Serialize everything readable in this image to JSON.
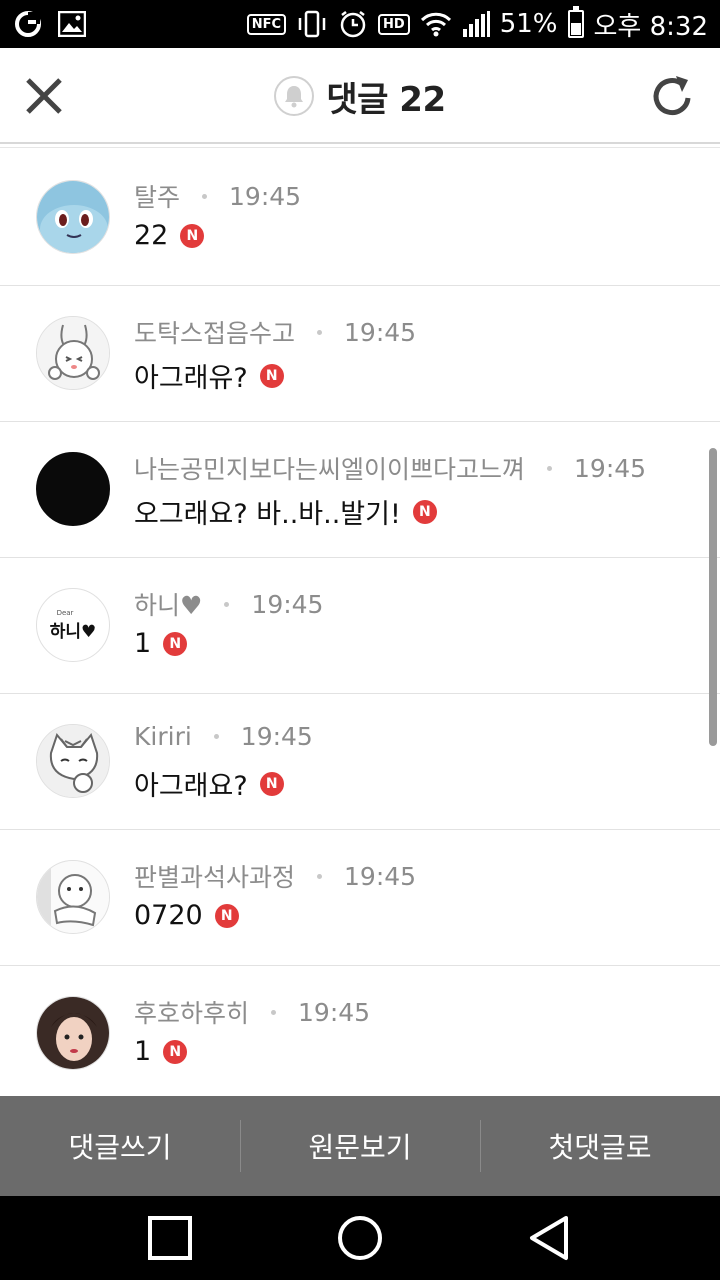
{
  "status_bar": {
    "nfc": "NFC",
    "hd": "HD",
    "battery_pct": "51%",
    "battery_level": 0.51,
    "time": "오후 8:32"
  },
  "header": {
    "title": "댓글 22",
    "close_icon": "close-icon",
    "bell_icon": "bell-icon",
    "refresh_icon": "refresh-icon"
  },
  "comments": [
    {
      "author": "탈주",
      "time": "19:45",
      "text": "22",
      "badge": "N",
      "avatar": "squirtle-avatar"
    },
    {
      "author": "도탁스접음수고",
      "time": "19:45",
      "text": "아그래유?",
      "badge": "N",
      "avatar": "bunny-avatar"
    },
    {
      "author": "나는공민지보다는씨엘이이쁘다고느껴",
      "time": "19:45",
      "text": "오그래요? 바..바..발기!",
      "badge": "N",
      "avatar": "black-avatar"
    },
    {
      "author": "하니♥",
      "time": "19:45",
      "text": "1",
      "badge": "N",
      "avatar": "hani-text-avatar",
      "avatar_text": "하니♥",
      "avatar_small": "Dear"
    },
    {
      "author": "Kiriri",
      "time": "19:45",
      "text": "아그래요?",
      "badge": "N",
      "avatar": "cat-avatar"
    },
    {
      "author": "판별과석사과정",
      "time": "19:45",
      "text": "0720",
      "badge": "N",
      "avatar": "duck-avatar"
    },
    {
      "author": "후호하후히",
      "time": "19:45",
      "text": "1",
      "badge": "N",
      "avatar": "photo-avatar"
    }
  ],
  "actions": {
    "write": "댓글쓰기",
    "original": "원문보기",
    "first": "첫댓글로"
  },
  "nav": {
    "recents_icon": "square-icon",
    "home_icon": "circle-icon",
    "back_icon": "triangle-back-icon"
  }
}
